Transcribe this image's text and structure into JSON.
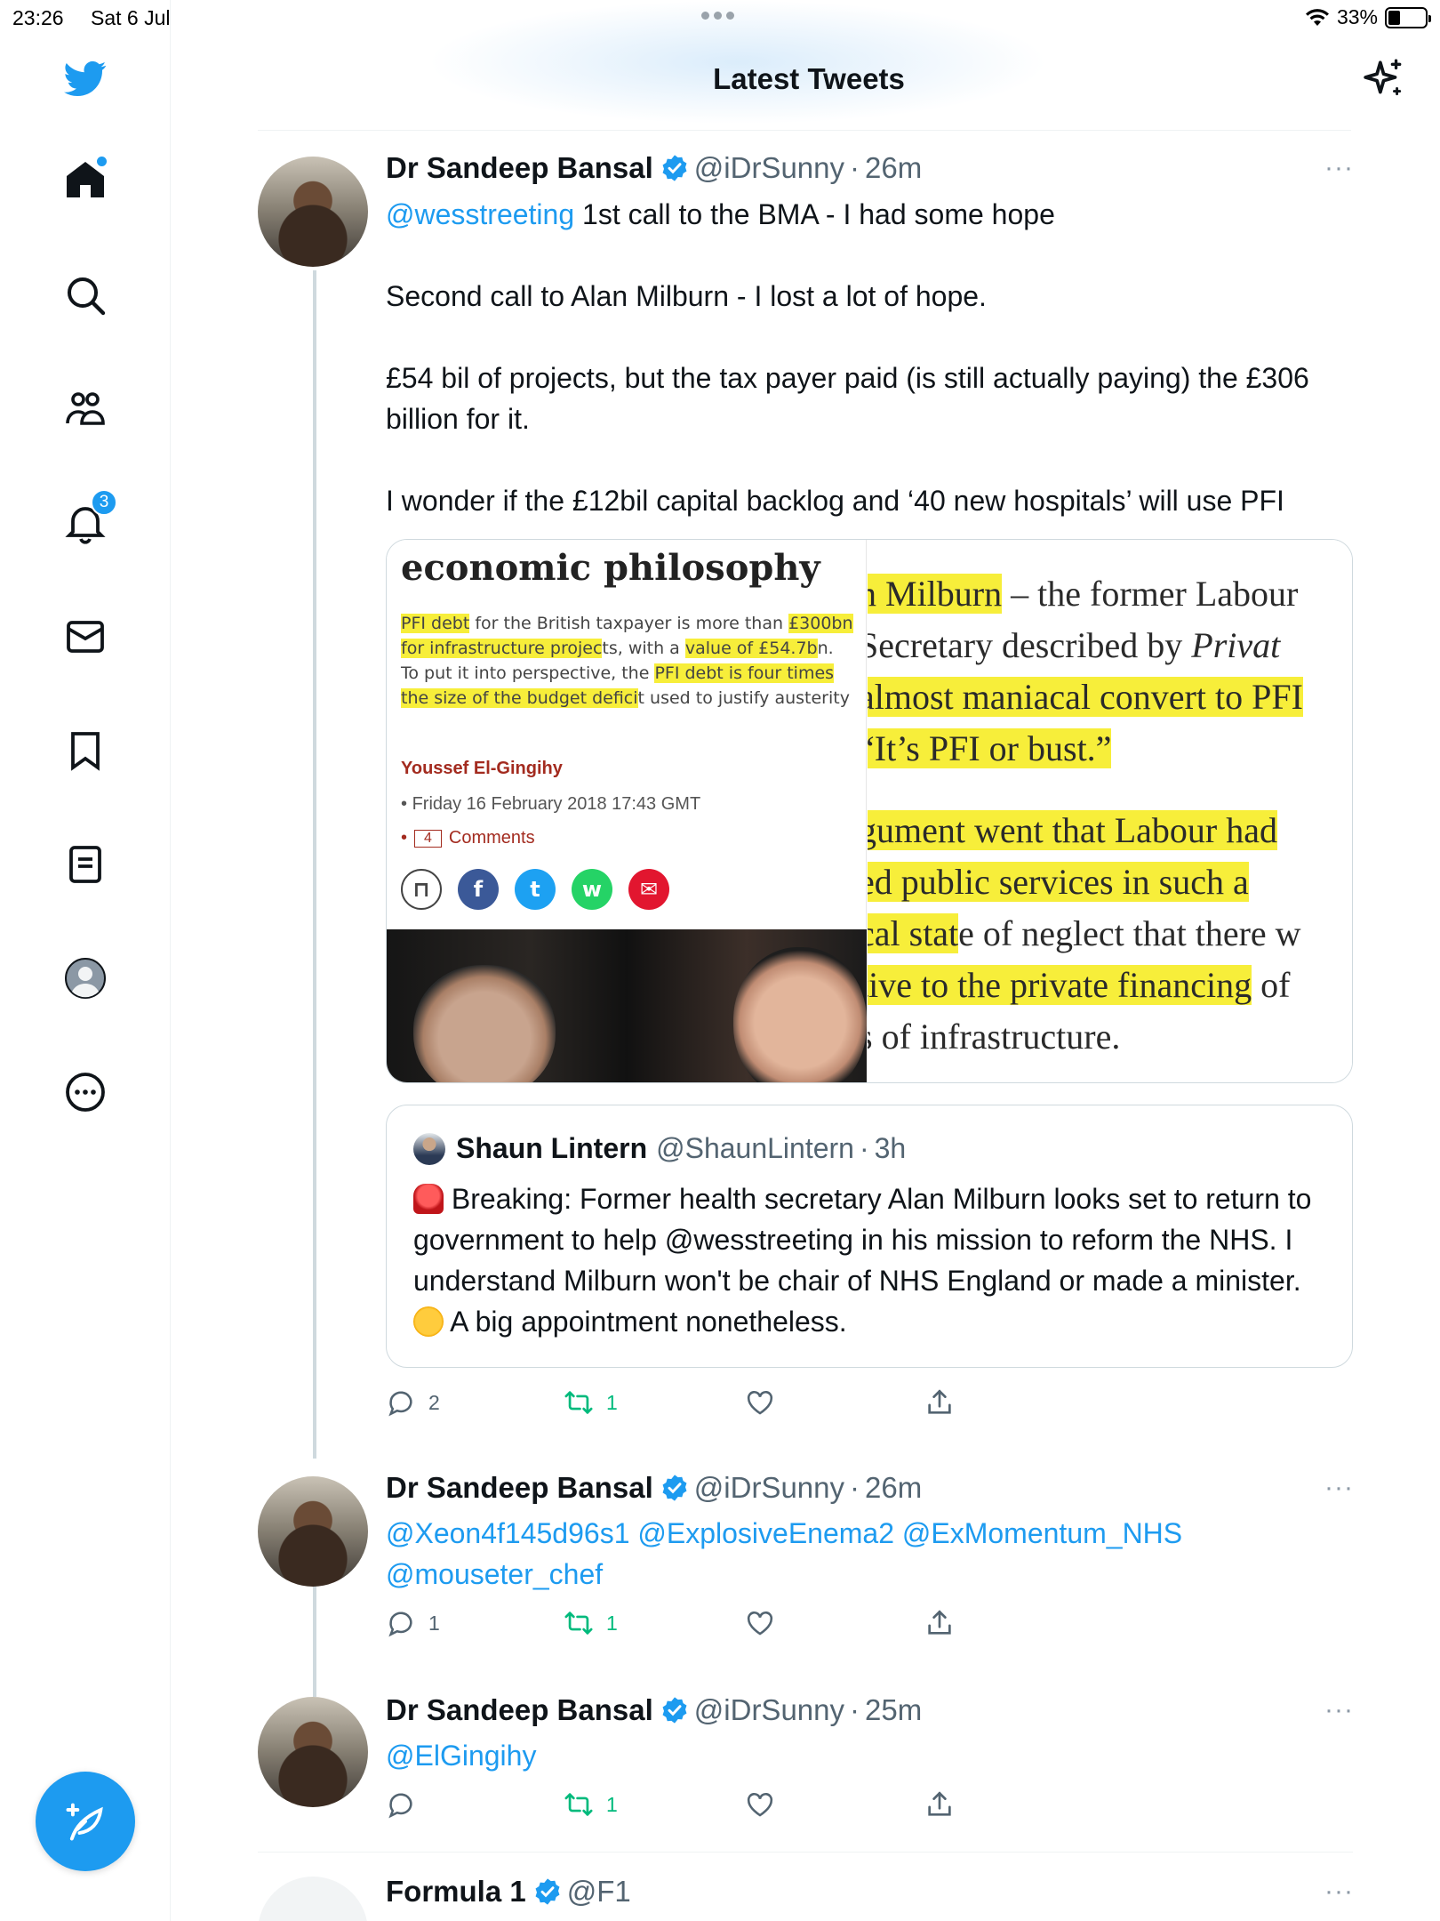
{
  "status_bar": {
    "time": "23:26",
    "date": "Sat 6 Jul",
    "battery": "33%",
    "battery_level": 0.33
  },
  "header": {
    "title": "Latest Tweets"
  },
  "sidebar": {
    "notification_count": "3"
  },
  "colors": {
    "accent": "#1d9bf0",
    "retweet": "#00ba7c",
    "muted": "#536471"
  },
  "tweets": [
    {
      "name": "Dr Sandeep Bansal",
      "handle": "@iDrSunny",
      "sep": "·",
      "time": "26m",
      "mention": "@wesstreeting",
      "text1": " 1st call to the BMA - I had some hope",
      "text2": "Second call to Alan Milburn - I lost a lot of hope.",
      "text3": "£54 bil of projects, but the tax payer paid (is still actually paying) the £306 billion for it.",
      "text4": "I wonder if the £12bil capital backlog and ‘40 new hospitals’ will use PFI",
      "replies": "2",
      "retweets": "1",
      "media": {
        "left_title": "economic philosophy",
        "left_body_1": "PFI debt",
        "left_body_2": " for the British taxpayer is more than ",
        "left_body_3": "£300bn",
        "left_body_4": " ",
        "left_body_5": "for infrastructure projec",
        "left_body_6": "ts, with a ",
        "left_body_7": "value of £54.7b",
        "left_body_8": "n. To put it into perspective, the ",
        "left_body_9": "PFI debt is four times the size of the budget defici",
        "left_body_10": "t used to justify austerity",
        "author": "Youssef El-Gingihy",
        "date": "Friday 16 February 2018 17:43 GMT",
        "comments_count": "4",
        "comments_label": "Comments",
        "right_l1a": "n Milburn",
        "right_l1b": " – the former Labour",
        "right_l2a": " Secretary described by ",
        "right_l2b": "Privat",
        "right_l3": "almost maniacal convert to PFI",
        "right_l4": "“It’s PFI or bust.”",
        "right_l5": "gument went that Labour had",
        "right_l6": "ed public services in such a",
        "right_l7a": "cal stat",
        "right_l7b": "e of neglect that there w",
        "right_l8a": "tive to the private financing",
        "right_l8b": " of",
        "right_l9": "s of infrastructure."
      },
      "quote": {
        "name": "Shaun Lintern",
        "handle": "@ShaunLintern",
        "sep": "·",
        "time": "3h",
        "text_a": " Breaking: Former health secretary Alan Milburn looks set to return to government to help @wesstreeting in his mission to reform the NHS. I understand Milburn won't be chair of NHS England or made a minister. ",
        "text_b": " A big appointment nonetheless."
      }
    },
    {
      "name": "Dr Sandeep Bansal",
      "handle": "@iDrSunny",
      "sep": "·",
      "time": "26m",
      "text": "@Xeon4f145d96s1 @ExplosiveEnema2 @ExMomentum_NHS @mouseter_chef",
      "replies": "1",
      "retweets": "1"
    },
    {
      "name": "Dr Sandeep Bansal",
      "handle": "@iDrSunny",
      "sep": "·",
      "time": "25m",
      "text": "@ElGingihy",
      "retweets": "1"
    },
    {
      "name": "Formula 1",
      "handle": "@F1"
    }
  ],
  "more_label": "···"
}
